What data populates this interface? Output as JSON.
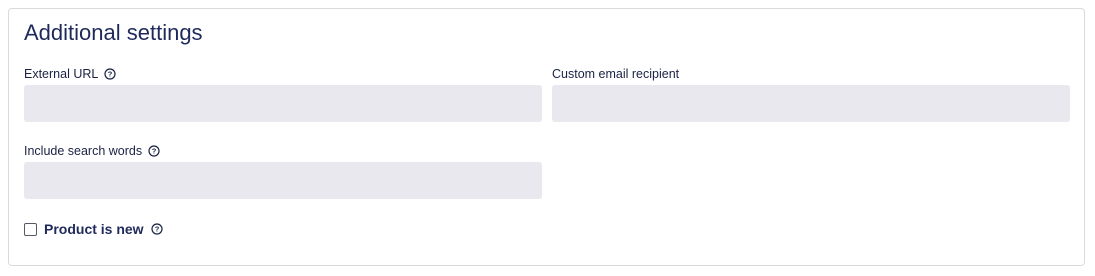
{
  "section": {
    "title": "Additional settings"
  },
  "fields": {
    "external_url": {
      "label": "External URL",
      "value": "",
      "placeholder": ""
    },
    "custom_email_recipient": {
      "label": "Custom email recipient",
      "value": "",
      "placeholder": ""
    },
    "include_search_words": {
      "label": "Include search words",
      "value": "",
      "placeholder": ""
    }
  },
  "product_is_new": {
    "label": "Product is new",
    "checked": false
  },
  "icons": {
    "help": "question-circle-icon"
  },
  "colors": {
    "title": "#1f2a5a",
    "input_bg": "#e8e8ee",
    "border": "#d9d9de"
  }
}
